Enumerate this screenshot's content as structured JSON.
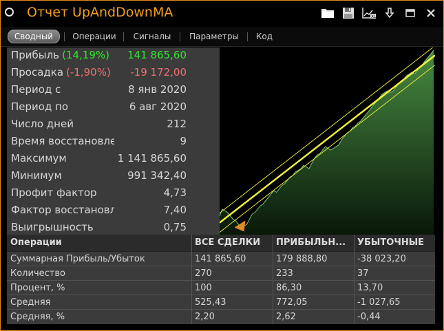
{
  "window": {
    "title": "Отчет UpAndDownMA"
  },
  "toolbar_icons": [
    "folder-icon",
    "save-icon",
    "chart-export-icon",
    "download-icon",
    "minimize-icon",
    "close-icon"
  ],
  "tabs": [
    {
      "label": "Сводный",
      "active": true
    },
    {
      "label": "Операции",
      "active": false
    },
    {
      "label": "Сигналы",
      "active": false
    },
    {
      "label": "Параметры",
      "active": false
    },
    {
      "label": "Код",
      "active": false
    }
  ],
  "stats": {
    "profit": {
      "label": "Прибыль",
      "pct": "(14,19%)",
      "value": "141 865,60"
    },
    "drawdown": {
      "label": "Просадка",
      "pct": "(-1,90%)",
      "value": "-19 172,00"
    },
    "rows": [
      {
        "label": "Период с",
        "value": "8 янв 2020"
      },
      {
        "label": "Период по",
        "value": "6 авг 2020"
      },
      {
        "label": "Число дней",
        "value": "212"
      },
      {
        "label": "Время восстановления",
        "value": "9"
      },
      {
        "label": "Максимум",
        "value": "1 141 865,60"
      },
      {
        "label": "Минимум",
        "value": "991 342,40"
      },
      {
        "label": "Профит фактор",
        "value": "4,73"
      },
      {
        "label": "Фактор восстановления",
        "value": "7,40"
      },
      {
        "label": "Выигрышность",
        "value": "0,75"
      }
    ]
  },
  "colors": {
    "accent": "#f4a01c",
    "profit": "#2ee62e",
    "loss": "#f07070",
    "chart_line": "#e8e83a",
    "chart_fill": "#3e7a3a"
  },
  "table": {
    "headers": [
      "Операции",
      "ВСЕ СДЕЛКИ",
      "ПРИБЫЛЬН...",
      "УБЫТОЧНЫЕ"
    ],
    "rows": [
      [
        "Суммарная Прибыль/Убыток",
        "141 865,60",
        "179 888,80",
        "-38 023,20"
      ],
      [
        "Количество",
        "270",
        "233",
        "37"
      ],
      [
        "Процент, %",
        "100",
        "86,30",
        "13,70"
      ],
      [
        "Средняя",
        "525,43",
        "772,05",
        "-1 027,65"
      ],
      [
        "Средняя, %",
        "2,20",
        "2,62",
        "-0,44"
      ]
    ]
  },
  "chart_data": {
    "type": "area",
    "series": [
      {
        "values": [
          0.02,
          0.06,
          0.05,
          0.04,
          0.02,
          0.0,
          -0.01,
          -0.03,
          -0.04,
          -0.04,
          -0.03,
          0.0,
          0.03,
          0.04,
          0.06,
          0.08,
          0.09,
          0.11,
          0.13,
          0.15,
          0.17,
          0.16,
          0.18,
          0.2,
          0.21,
          0.23,
          0.25,
          0.26,
          0.28,
          0.29,
          0.3,
          0.32,
          0.31,
          0.3,
          0.33,
          0.36,
          0.38,
          0.39,
          0.41,
          0.43,
          0.42,
          0.41,
          0.42,
          0.43,
          0.44,
          0.47,
          0.49,
          0.51,
          0.52,
          0.54,
          0.55,
          0.57,
          0.58,
          0.6,
          0.62,
          0.64,
          0.66,
          0.68,
          0.7,
          0.72,
          0.74,
          0.75,
          0.76,
          0.75,
          0.76,
          0.78,
          0.8,
          0.82,
          0.83,
          0.85,
          0.86,
          0.87,
          0.86,
          0.88,
          0.9,
          0.92,
          0.94,
          0.96,
          0.98,
          1.0
        ]
      }
    ]
  }
}
